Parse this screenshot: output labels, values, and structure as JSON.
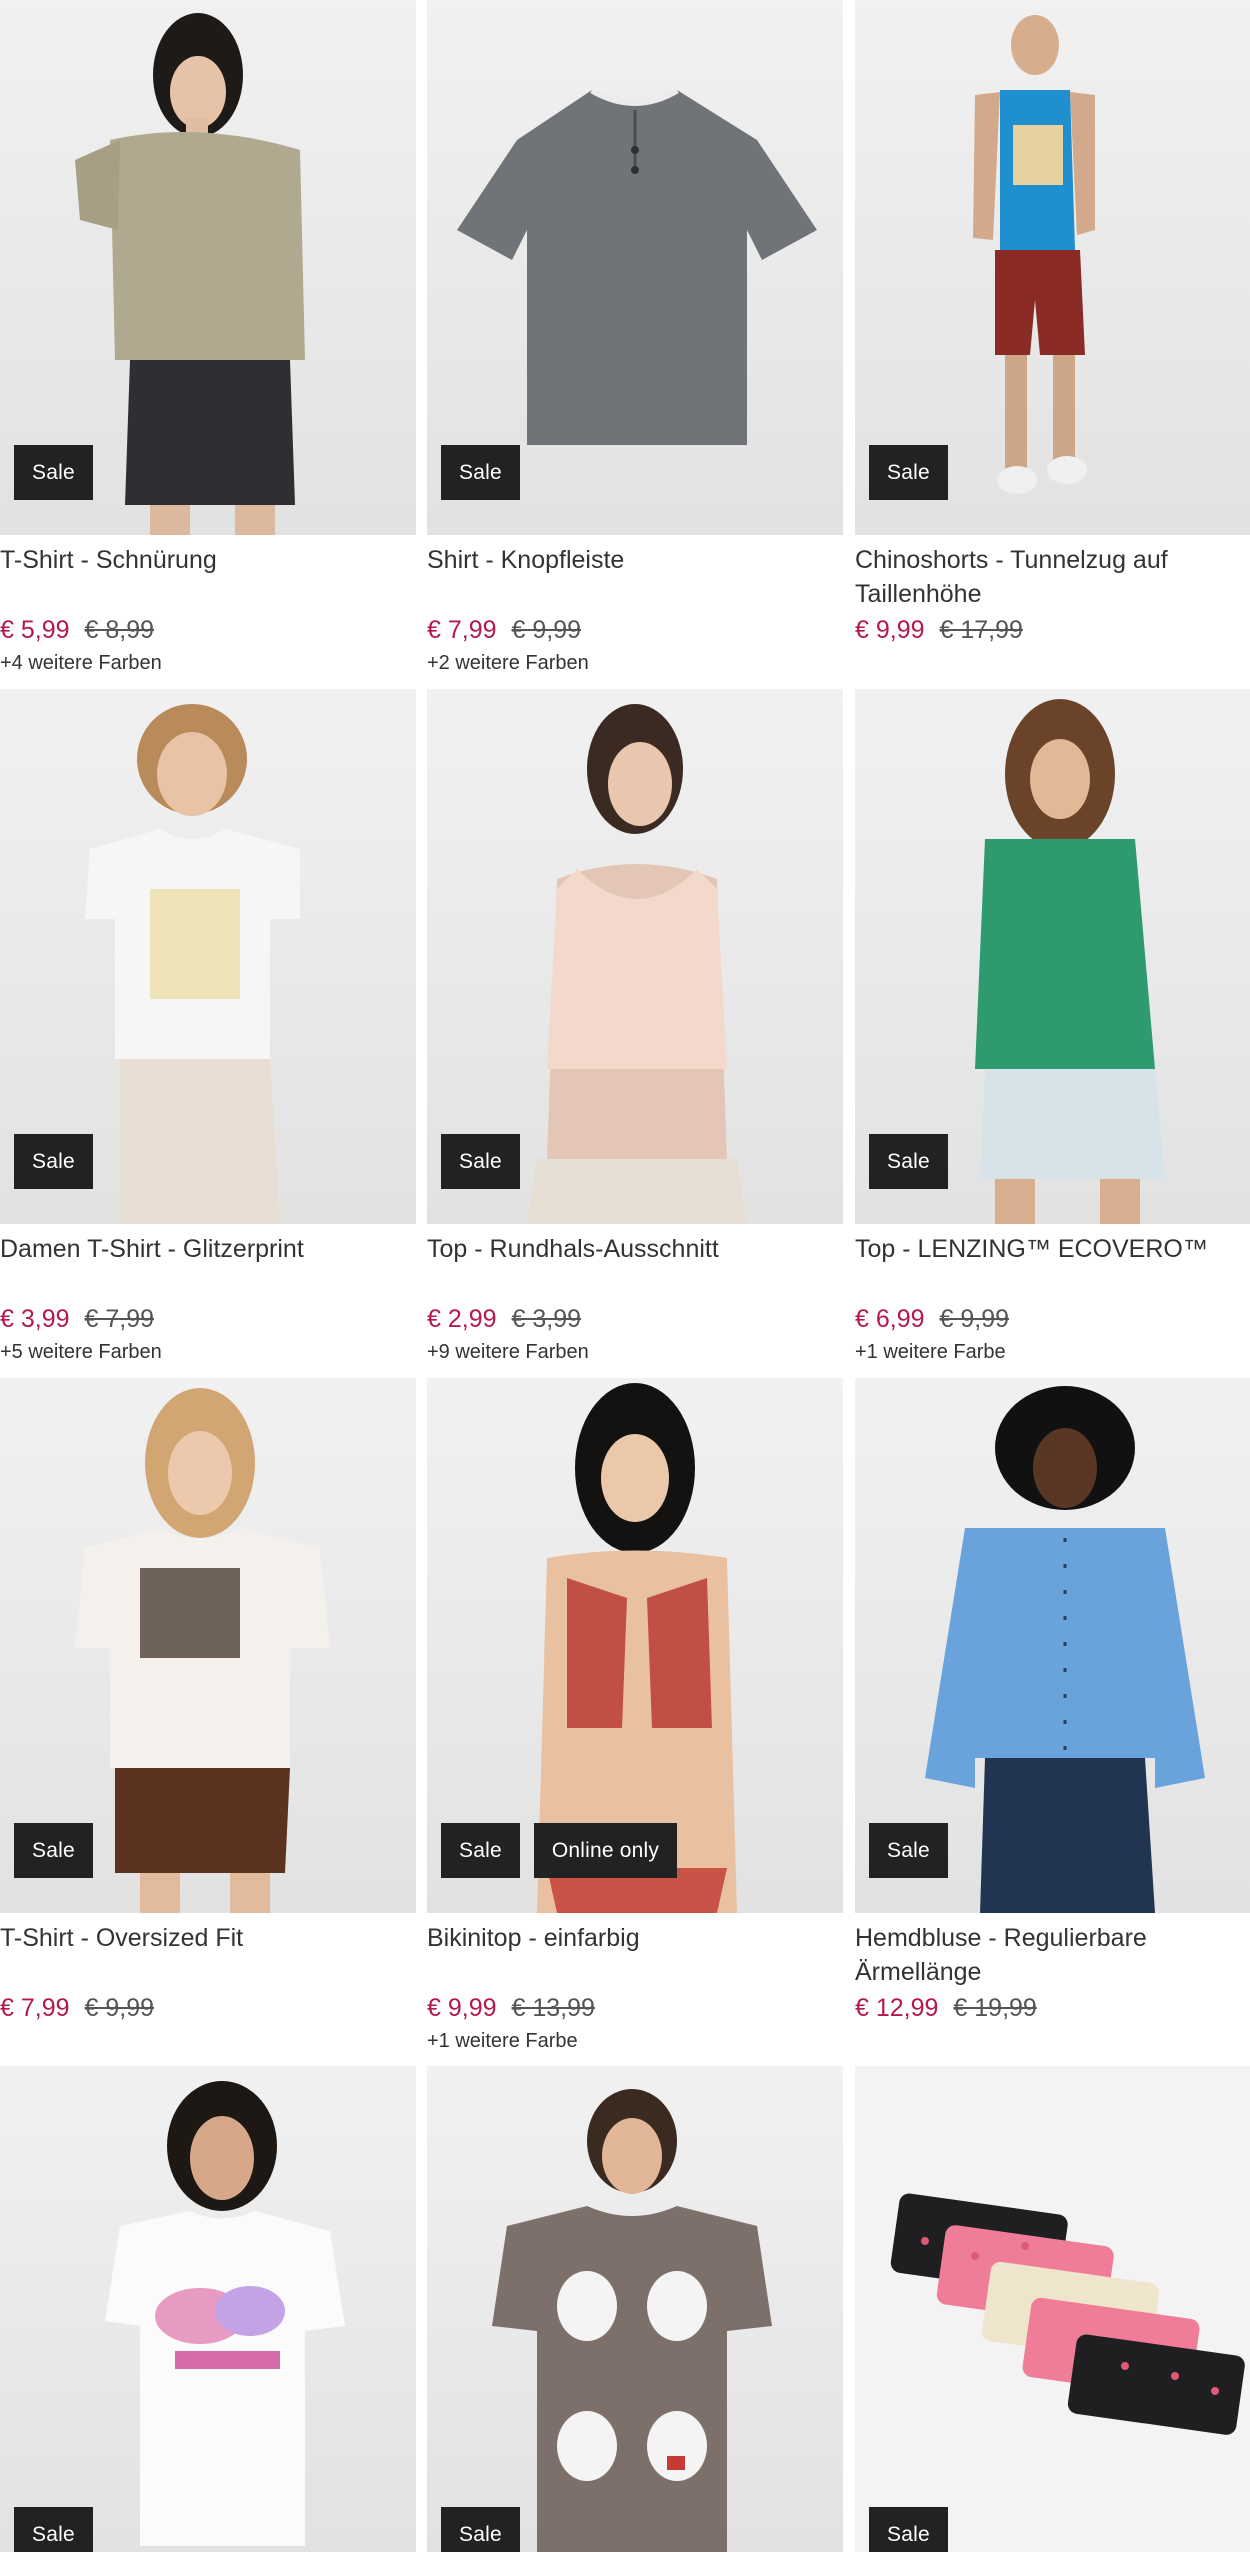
{
  "products": [
    {
      "name": "T-Shirt - Schnürung",
      "price": "€ 5,99",
      "old_price": "€ 8,99",
      "colors": "+4 weitere Farben",
      "badges": [
        "Sale"
      ],
      "image": "woman-beige-tshirt-photo"
    },
    {
      "name": "Shirt - Knopfleiste",
      "price": "€ 7,99",
      "old_price": "€ 9,99",
      "colors": "+2 weitere Farben",
      "badges": [
        "Sale"
      ],
      "image": "grey-henley-shirt-photo"
    },
    {
      "name": "Chinoshorts - Tunnelzug auf Taillenhöhe",
      "price": "€ 9,99",
      "old_price": "€ 17,99",
      "colors": "",
      "badges": [
        "Sale"
      ],
      "image": "man-chino-shorts-photo"
    },
    {
      "name": "Damen T-Shirt - Glitzerprint",
      "price": "€ 3,99",
      "old_price": "€ 7,99",
      "colors": "+5 weitere Farben",
      "badges": [
        "Sale"
      ],
      "image": "woman-white-print-tshirt-photo"
    },
    {
      "name": "Top - Rundhals-Ausschnitt",
      "price": "€ 2,99",
      "old_price": "€ 3,99",
      "colors": "+9 weitere Farben",
      "badges": [
        "Sale"
      ],
      "image": "woman-pink-top-photo"
    },
    {
      "name": "Top - LENZING™ ECOVERO™",
      "price": "€ 6,99",
      "old_price": "€ 9,99",
      "colors": "+1 weitere Farbe",
      "badges": [
        "Sale"
      ],
      "image": "woman-green-top-photo"
    },
    {
      "name": "T-Shirt - Oversized Fit",
      "price": "€ 7,99",
      "old_price": "€ 9,99",
      "colors": "",
      "badges": [
        "Sale"
      ],
      "image": "woman-oversized-tshirt-photo"
    },
    {
      "name": "Bikinitop - einfarbig",
      "price": "€ 9,99",
      "old_price": "€ 13,99",
      "colors": "+1 weitere Farbe",
      "badges": [
        "Sale",
        "Online only"
      ],
      "image": "woman-red-bikini-photo"
    },
    {
      "name": "Hemdbluse - Regulierbare Ärmellänge",
      "price": "€ 12,99",
      "old_price": "€ 19,99",
      "colors": "",
      "badges": [
        "Sale"
      ],
      "image": "woman-blue-blouse-photo"
    },
    {
      "name": "",
      "price": "",
      "old_price": "",
      "colors": "",
      "badges": [
        "Sale"
      ],
      "image": "woman-happiness-tshirt-photo"
    },
    {
      "name": "",
      "price": "",
      "old_price": "",
      "colors": "",
      "badges": [
        "Sale"
      ],
      "image": "woman-snoopy-tshirt-photo"
    },
    {
      "name": "",
      "price": "",
      "old_price": "",
      "colors": "",
      "badges": [
        "Sale"
      ],
      "image": "panties-set-photo"
    }
  ],
  "colors": {
    "price": "#b5184f",
    "badge_bg": "#222222",
    "badge_text": "#ffffff"
  }
}
